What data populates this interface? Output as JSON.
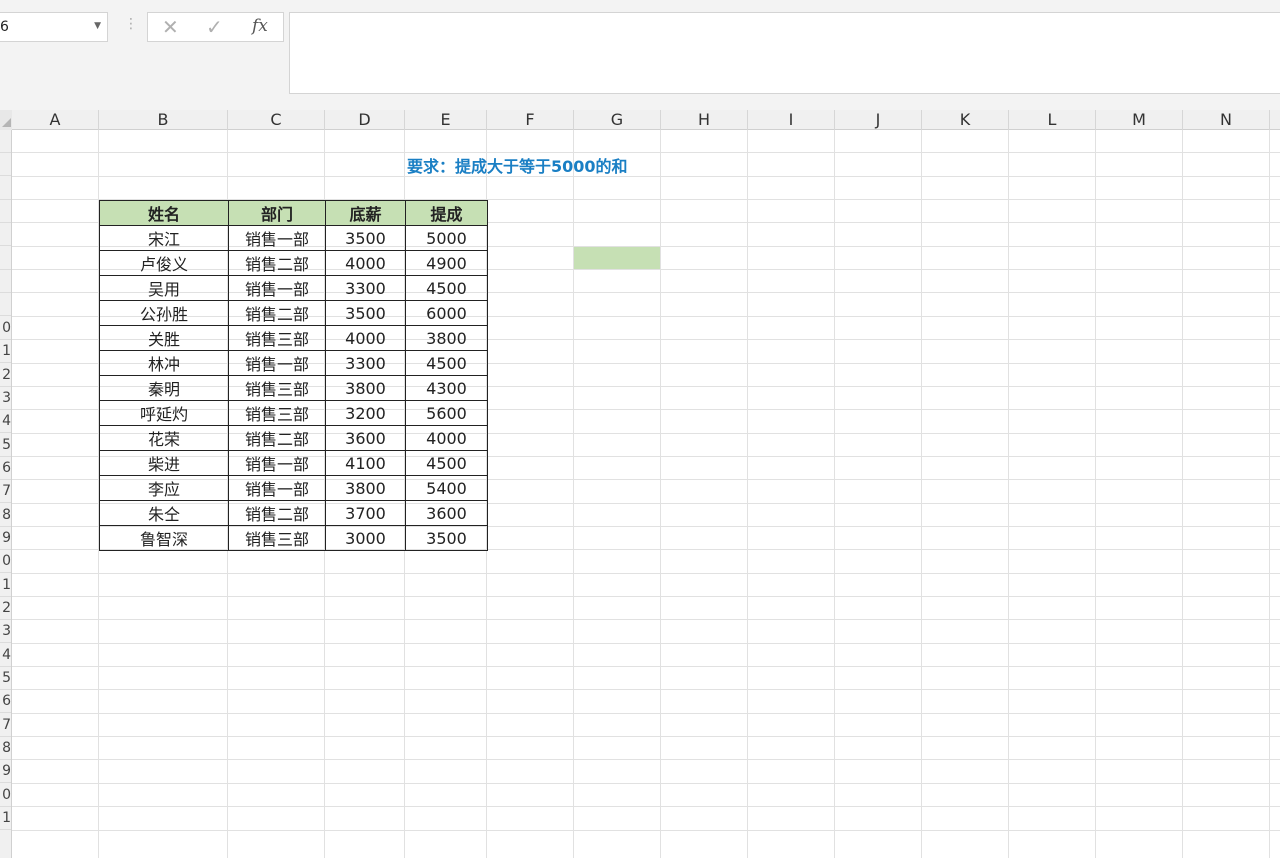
{
  "formula_bar": {
    "name_box": "6",
    "separator": "⋮",
    "cancel_icon": "✕",
    "enter_icon": "✓",
    "fx_label": "fx",
    "formula": ""
  },
  "columns": [
    "A",
    "B",
    "C",
    "D",
    "E",
    "F",
    "G",
    "H",
    "I",
    "J",
    "K",
    "L",
    "M",
    "N"
  ],
  "rows": [
    "",
    "",
    "",
    "",
    "",
    "",
    "",
    "",
    "0",
    "1",
    "2",
    "3",
    "4",
    "5",
    "6",
    "7",
    "8",
    "9",
    "0",
    "1",
    "2",
    "3",
    "4",
    "5",
    "6",
    "7",
    "8",
    "9",
    "0",
    "1"
  ],
  "title": "要求：提成大于等于5000的和",
  "table": {
    "headers": [
      "姓名",
      "部门",
      "底薪",
      "提成"
    ],
    "rows": [
      [
        "宋江",
        "销售一部",
        "3500",
        "5000"
      ],
      [
        "卢俊义",
        "销售二部",
        "4000",
        "4900"
      ],
      [
        "吴用",
        "销售一部",
        "3300",
        "4500"
      ],
      [
        "公孙胜",
        "销售二部",
        "3500",
        "6000"
      ],
      [
        "关胜",
        "销售三部",
        "4000",
        "3800"
      ],
      [
        "林冲",
        "销售一部",
        "3300",
        "4500"
      ],
      [
        "秦明",
        "销售三部",
        "3800",
        "4300"
      ],
      [
        "呼延灼",
        "销售三部",
        "3200",
        "5600"
      ],
      [
        "花荣",
        "销售二部",
        "3600",
        "4000"
      ],
      [
        "柴进",
        "销售一部",
        "4100",
        "4500"
      ],
      [
        "李应",
        "销售一部",
        "3800",
        "5400"
      ],
      [
        "朱仝",
        "销售二部",
        "3700",
        "3600"
      ],
      [
        "鲁智深",
        "销售三部",
        "3000",
        "3500"
      ]
    ]
  },
  "colors": {
    "header_fill": "#c6e0b4",
    "selection_fill": "#c6e0b4",
    "title_color": "#1a7fc4"
  }
}
